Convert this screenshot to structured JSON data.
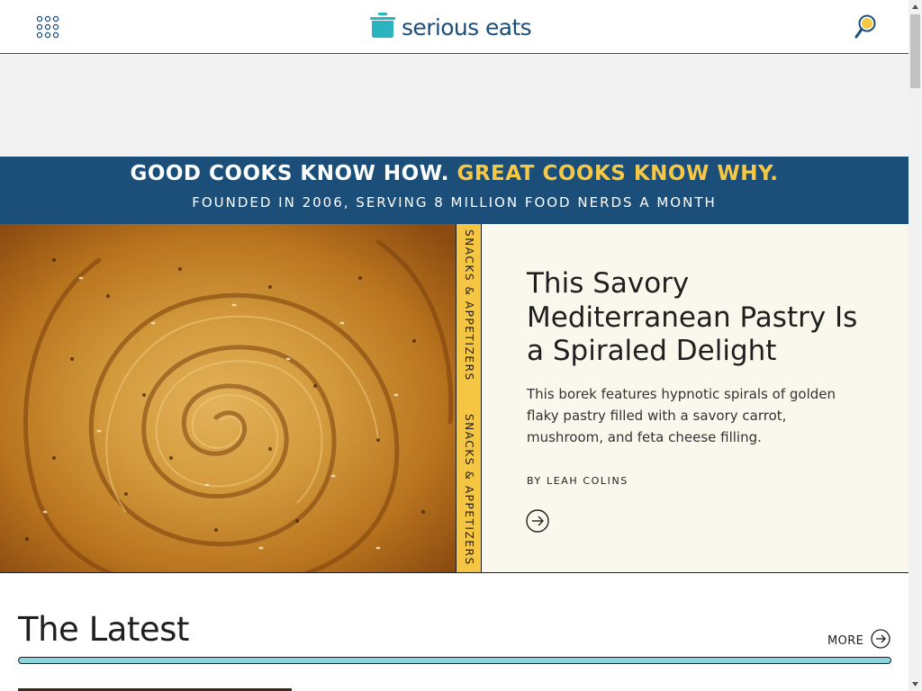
{
  "header": {
    "logo_text": "serious eats"
  },
  "icons": {
    "menu": "grid-dots-icon",
    "logo": "pot-icon",
    "search": "magnifier-icon",
    "arrow": "arrow-circle-right-icon"
  },
  "banner": {
    "line1_part1": "GOOD COOKS KNOW HOW.",
    "line1_part2": "GREAT COOKS KNOW WHY.",
    "line2": "FOUNDED IN 2006, SERVING 8 MILLION FOOD NERDS A MONTH"
  },
  "hero": {
    "category": "SNACKS & APPETIZERS",
    "title": "This Savory Mediterranean Pastry Is a Spiraled Delight",
    "description": "This borek features hypnotic spirals of golden flaky pastry filled with a savory carrot, mushroom, and feta cheese filling.",
    "byline_prefix": "BY",
    "author": "LEAH COLINS"
  },
  "latest": {
    "heading": "The Latest",
    "more_label": "MORE"
  },
  "colors": {
    "brand_blue": "#1b4f7a",
    "logo_teal": "#2bb3c0",
    "accent_yellow": "#f7c843",
    "category_yellow": "#f5c643",
    "card_cream": "#faf7ed",
    "latest_rule": "#8ad6e0"
  }
}
